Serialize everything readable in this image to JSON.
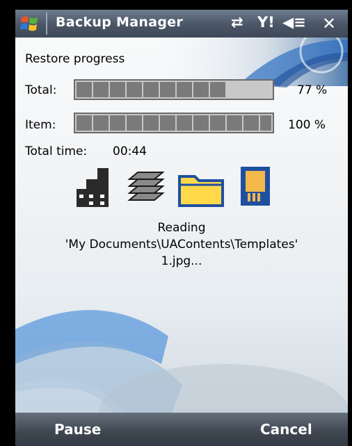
{
  "window": {
    "title": "Backup Manager",
    "close_label": "✕",
    "tray_icons": [
      "sync-icon",
      "signal-icon",
      "volume-icon"
    ]
  },
  "restore": {
    "heading": "Restore progress",
    "total_label": "Total:",
    "total_percent_text": "77 %",
    "total_progress": 0.77,
    "item_label": "Item:",
    "item_percent_text": "100 %",
    "item_progress": 1.0,
    "time_label": "Total time:",
    "time_value": "00:44",
    "stage_icons": [
      "storage-stack-icon",
      "pages-stack-icon",
      "folder-icon",
      "sd-card-icon"
    ],
    "status_line1": "Reading",
    "status_line2": "'My Documents\\UAContents\\Templates'",
    "status_line3": "1.jpg..."
  },
  "softkeys": {
    "left": "Pause",
    "right": "Cancel"
  },
  "colors": {
    "titlebar": "#4a5566",
    "softkey_bar": "#3e4650",
    "progress_fill": "#7a7a7a",
    "folder": "#ffd94a",
    "sd_card": "#1f4fa0"
  }
}
